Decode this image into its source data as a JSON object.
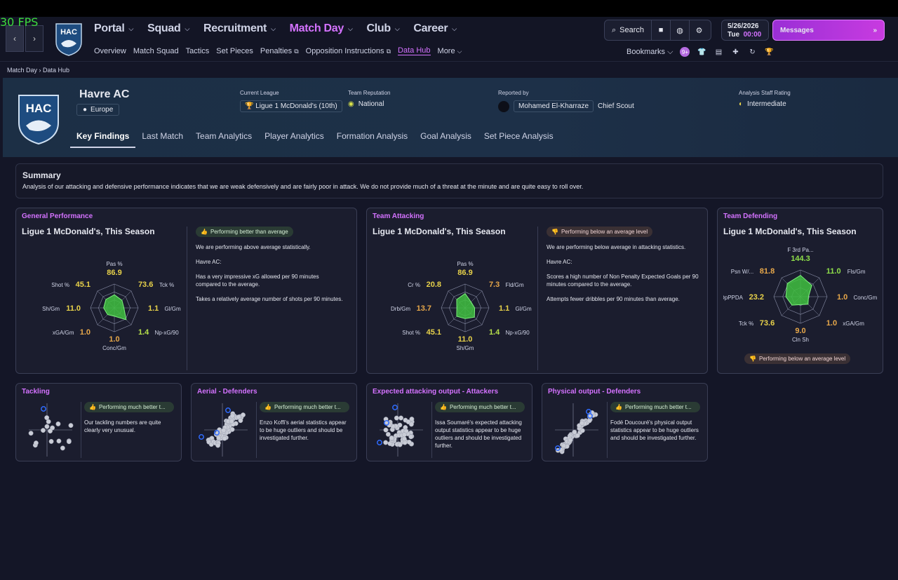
{
  "fps": "30 FPS",
  "nav": {
    "back": "‹",
    "forward": "›"
  },
  "menu": [
    {
      "label": "Portal",
      "active": false
    },
    {
      "label": "Squad",
      "active": false
    },
    {
      "label": "Recruitment",
      "active": false
    },
    {
      "label": "Match Day",
      "active": true
    },
    {
      "label": "Club",
      "active": false
    },
    {
      "label": "Career",
      "active": false
    }
  ],
  "submenu": [
    "Overview",
    "Match Squad",
    "Tactics",
    "Set Pieces",
    "Penalties",
    "Opposition Instructions",
    "Data Hub",
    "More"
  ],
  "search_label": "Search",
  "date": {
    "date": "5/26/2026",
    "day": "Tue",
    "time": "00:00"
  },
  "messages_label": "Messages",
  "bookmarks_label": "Bookmarks",
  "notification_count": "9+",
  "breadcrumb": {
    "parent": "Match Day",
    "current": "Data Hub"
  },
  "logo_text": "HAC",
  "team": {
    "name": "Havre AC",
    "region": "Europe"
  },
  "meta": {
    "league_label": "Current League",
    "league_value": "Ligue 1 McDonald's (10th)",
    "rep_label": "Team Reputation",
    "rep_value": "National",
    "reported_label": "Reported by",
    "reporter": "Mohamed El-Kharraze",
    "reporter_role": "Chief Scout",
    "rating_label": "Analysis Staff Rating",
    "rating_value": "Intermediate"
  },
  "tabs": [
    "Key Findings",
    "Last Match",
    "Team Analytics",
    "Player Analytics",
    "Formation Analysis",
    "Goal Analysis",
    "Set Piece Analysis"
  ],
  "summary": {
    "title": "Summary",
    "text": "Analysis of our attacking and defensive performance indicates that we are weak defensively and are fairly poor in attack. We do not provide much of a threat at the minute and are quite easy to roll over."
  },
  "general": {
    "title": "General Performance",
    "subtitle": "Ligue 1 McDonald's, This Season",
    "status": "Performing better than average",
    "p1": "We are performing above average statistically.",
    "p2": "Havre AC:",
    "p3": "Has a very impressive xG allowed per 90 minutes compared to the average.",
    "p4": "Takes a relatively average number of shots per 90 minutes.",
    "radar": [
      {
        "label": "Pas %",
        "value": "86.9",
        "color": "#e8d24a"
      },
      {
        "label": "Tck %",
        "value": "73.6",
        "color": "#e8d24a"
      },
      {
        "label": "Gl/Gm",
        "value": "1.1",
        "color": "#e8d24a"
      },
      {
        "label": "Np-xG/90",
        "value": "1.4",
        "color": "#b6e04a"
      },
      {
        "label": "Conc/Gm",
        "value": "1.0",
        "color": "#e8a84a"
      },
      {
        "label": "xGA/Gm",
        "value": "1.0",
        "color": "#e8a84a"
      },
      {
        "label": "Sh/Gm",
        "value": "11.0",
        "color": "#e8d24a"
      },
      {
        "label": "Shot %",
        "value": "45.1",
        "color": "#e8d24a"
      }
    ]
  },
  "attacking": {
    "title": "Team Attacking",
    "subtitle": "Ligue 1 McDonald's, This Season",
    "status": "Performing below an average level",
    "p1": "We are performing below average in attacking statistics.",
    "p2": "Havre AC:",
    "p3": "Scores a high number of Non Penalty Expected Goals per 90 minutes compared to the average.",
    "p4": "Attempts fewer dribbles per 90 minutes than average.",
    "radar": [
      {
        "label": "Pas %",
        "value": "86.9",
        "color": "#e8d24a"
      },
      {
        "label": "Fld/Gm",
        "value": "7.3",
        "color": "#e8a84a"
      },
      {
        "label": "Gl/Gm",
        "value": "1.1",
        "color": "#e8d24a"
      },
      {
        "label": "Np-xG/90",
        "value": "1.4",
        "color": "#b6e04a"
      },
      {
        "label": "Sh/Gm",
        "value": "11.0",
        "color": "#e8d24a"
      },
      {
        "label": "Shot %",
        "value": "45.1",
        "color": "#e8d24a"
      },
      {
        "label": "Drb/Gm",
        "value": "13.7",
        "color": "#e8a84a"
      },
      {
        "label": "Cr %",
        "value": "20.8",
        "color": "#e8d24a"
      }
    ]
  },
  "defending": {
    "title": "Team Defending",
    "subtitle": "Ligue 1 McDonald's, This Season",
    "status": "Performing below an average level",
    "radar": [
      {
        "label": "F 3rd Pa...",
        "value": "144.3",
        "color": "#8fe04a"
      },
      {
        "label": "Fls/Gm",
        "value": "11.0",
        "color": "#8fe04a"
      },
      {
        "label": "Conc/Gm",
        "value": "1.0",
        "color": "#e8a84a"
      },
      {
        "label": "xGA/Gm",
        "value": "1.0",
        "color": "#e8a84a"
      },
      {
        "label": "Cln Sh",
        "value": "9.0",
        "color": "#e8a84a"
      },
      {
        "label": "Tck %",
        "value": "73.6",
        "color": "#e8d24a"
      },
      {
        "label": "OpPPDA",
        "value": "23.2",
        "color": "#e8d24a"
      },
      {
        "label": "Psn W/...",
        "value": "81.8",
        "color": "#e8a84a"
      }
    ]
  },
  "small": [
    {
      "title": "Tackling",
      "status": "Performing much better t...",
      "text": "Our tackling numbers are quite clearly very unusual."
    },
    {
      "title": "Aerial - Defenders",
      "status": "Performing much better t...",
      "text": "Enzo Koffi's aerial statistics appear to be huge outliers and should be investigated further."
    },
    {
      "title": "Expected attacking output - Attackers",
      "status": "Performing much better t...",
      "text": "Issa Soumaré's expected attacking output statistics appear to be huge outliers and should be investigated further."
    },
    {
      "title": "Physical output - Defenders",
      "status": "Performing much better t...",
      "text": "Fodé Doucouré's physical output statistics appear to be huge outliers and should be investigated further."
    }
  ]
}
